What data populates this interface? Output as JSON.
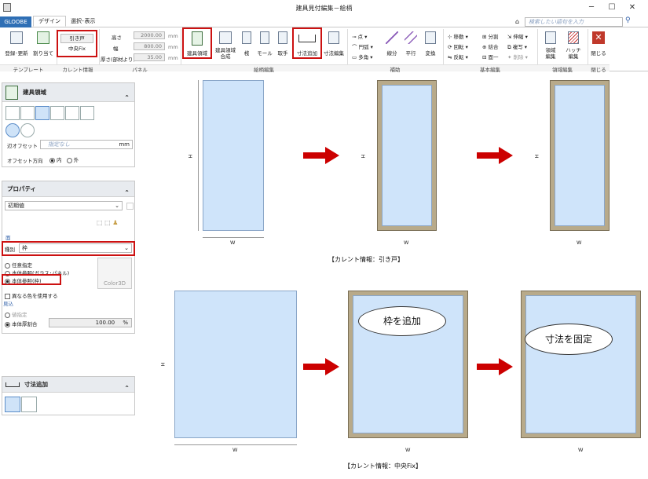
{
  "window": {
    "title": "建具見付編集－絵柄"
  },
  "tabs": {
    "app": "GLOOBE",
    "design": "デザイン",
    "select": "選択･表示"
  },
  "search": {
    "placeholder": "検索したい語句を入力"
  },
  "ribbon": {
    "template": {
      "register": "登録･更新",
      "assign": "割り当て",
      "label": "テンプレート"
    },
    "current": {
      "sliding": "引き戸",
      "center": "中央Fix",
      "label": "カレント情報"
    },
    "panel": {
      "height_label": "高さ",
      "height_val": "2000.00",
      "width_label": "幅",
      "width_val": "800.00",
      "thick_label": "厚さ(部材より)",
      "thick_val": "35.00",
      "unit": "mm",
      "label": "パネル"
    },
    "pattern": {
      "area": "建具領域",
      "area_comp": "建具領域\n合成",
      "line": "桟",
      "mall": "モール",
      "handle": "取手",
      "dim": "寸法追加",
      "dim_edit": "寸法編集",
      "label": "絵柄編集"
    },
    "aux": {
      "point": "点",
      "arc": "円弧",
      "poly": "多角",
      "line": "線分",
      "parallel": "平行",
      "convert": "変換",
      "label": "補助"
    },
    "edit": {
      "move": "移動",
      "rotate": "回転",
      "mirror": "反転",
      "split": "分割",
      "join": "結合",
      "merge": "面一",
      "stretch": "伸縮",
      "copy": "複写",
      "delete": "削除",
      "label": "基本編集"
    },
    "region": {
      "region": "領域\n編集",
      "hatch": "ハッチ\n編集",
      "label": "領域編集"
    },
    "close": {
      "close": "閉じる",
      "label": "閉じる"
    }
  },
  "left": {
    "area": {
      "title": "建具領域",
      "offset_label": "辺オフセット",
      "offset_ph": "指定なし",
      "offset_unit": "mm",
      "dir_label": "オフセット方向",
      "dir_in": "内",
      "dir_out": "外"
    },
    "prop": {
      "title": "プロパティ",
      "preset": "初期値",
      "face_label": "面",
      "kind_label": "種別",
      "kind_val": "枠",
      "opt1": "任意指定",
      "opt2": "本体参照(ガラス･パネル)",
      "opt3": "本体参照(枠)",
      "color": "Color3D",
      "diffcolor": "異なる色を使用する",
      "mikomi": "見込",
      "val_spec": "値指定",
      "ratio": "本体厚割合",
      "ratio_val": "100.00",
      "pct": "%"
    },
    "dim": {
      "title": "寸法追加"
    }
  },
  "canvas": {
    "w": "W",
    "h": "H",
    "caption1": "【カレント情報：引き戸】",
    "caption2": "【カレント情報：中央Fix】",
    "bubble1": "枠を追加",
    "bubble2": "寸法を固定"
  }
}
